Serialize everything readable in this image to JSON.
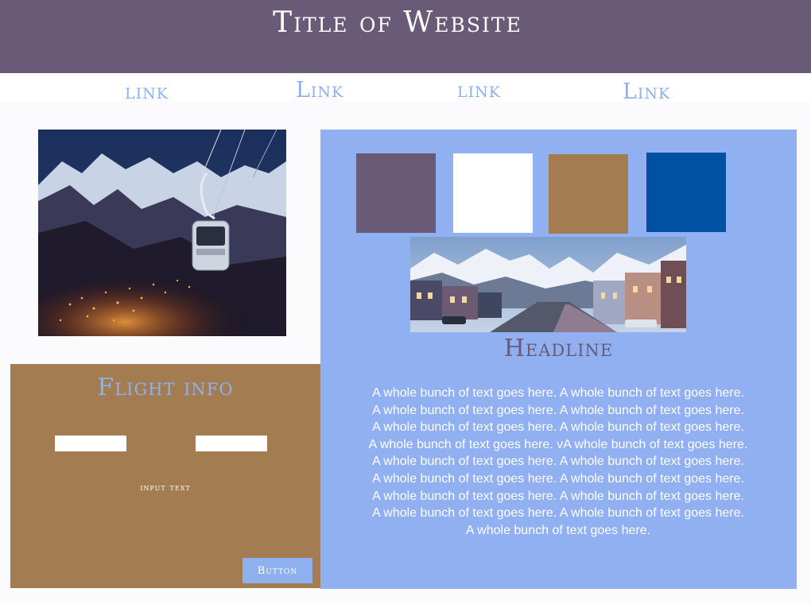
{
  "header": {
    "title": "Title of Website"
  },
  "nav": {
    "links": [
      {
        "label": "link"
      },
      {
        "label": "Link"
      },
      {
        "label": "link"
      },
      {
        "label": "Link"
      }
    ]
  },
  "flight": {
    "title": "Flight info",
    "input_label": "input text",
    "button_label": "Button"
  },
  "content": {
    "swatches": [
      {
        "color": "#695a78"
      },
      {
        "color": "#ffffff"
      },
      {
        "color": "#a47c51"
      },
      {
        "color": "#0051a2"
      }
    ],
    "headline": "Headline",
    "body": "A whole bunch of text goes here. A whole bunch of text goes here. A whole bunch of text goes here. A whole bunch of text goes here. A whole bunch of text goes here. A whole bunch of text goes here. A whole bunch of text goes here. vA whole bunch of text goes here. A whole bunch of text goes here. A whole bunch of text goes here. A whole bunch of text goes here. A whole bunch of text goes here. A whole bunch of text goes here. A whole bunch of text goes here. A whole bunch of text goes here. A whole bunch of text goes here. A whole bunch of text goes here."
  }
}
